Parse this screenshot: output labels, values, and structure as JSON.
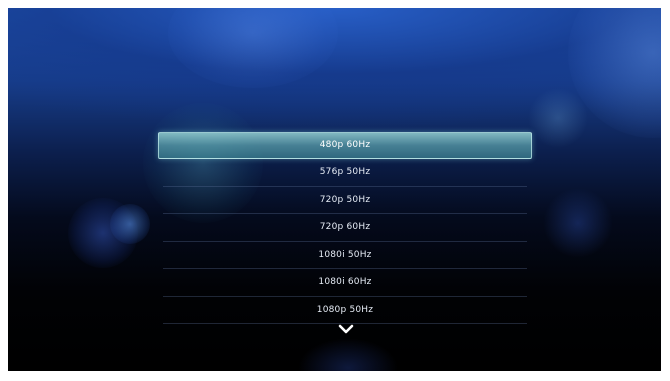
{
  "menu": {
    "items": [
      {
        "label": "480p 60Hz"
      },
      {
        "label": "576p 50Hz"
      },
      {
        "label": "720p 50Hz"
      },
      {
        "label": "720p 60Hz"
      },
      {
        "label": "1080i 50Hz"
      },
      {
        "label": "1080i 60Hz"
      },
      {
        "label": "1080p 50Hz"
      }
    ],
    "selected_index": 0,
    "scroll_icon": "chevron-down-icon"
  },
  "colors": {
    "highlight": "#6fb3b8",
    "background_top": "#1e4fa8",
    "background_bottom": "#000000",
    "text": "#e6ecf5"
  }
}
